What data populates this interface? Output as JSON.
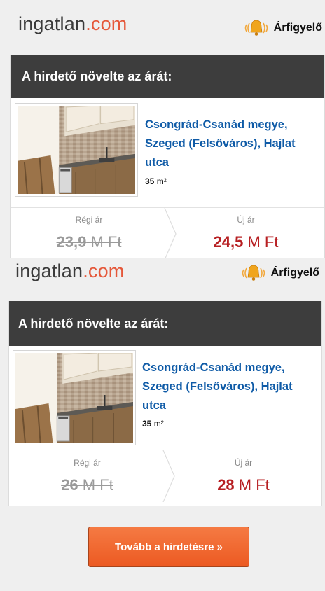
{
  "brand": {
    "logo_part1": "ingatlan",
    "logo_part2": ".com"
  },
  "price_watch": {
    "label": "Árfigyelő",
    "icon": "bell-icon"
  },
  "notices": [
    {
      "heading": "A hirdető növelte az árát:",
      "address": "Csongrád-Csanád megye, Szeged (Felsőváros), Hajlat utca",
      "area_value": "35",
      "area_unit": "m²",
      "old_label": "Régi ár",
      "old_value": "23,9",
      "old_unit": "M Ft",
      "new_label": "Új ár",
      "new_value": "24,5",
      "new_unit": "M Ft"
    },
    {
      "heading": "A hirdető növelte az árát:",
      "address": "Csongrád-Csanád megye, Szeged (Felsőváros), Hajlat utca",
      "area_value": "35",
      "area_unit": "m²",
      "old_label": "Régi ár",
      "old_value": "26",
      "old_unit": "M Ft",
      "new_label": "Új ár",
      "new_value": "28",
      "new_unit": "M Ft"
    }
  ],
  "cta": {
    "label": "Tovább a hirdetésre »"
  },
  "colors": {
    "header": "#3d3d3d",
    "link": "#0f5ba7",
    "new_price": "#b71f22",
    "cta": "#ef6a2f",
    "logo_accent": "#e5583a"
  }
}
